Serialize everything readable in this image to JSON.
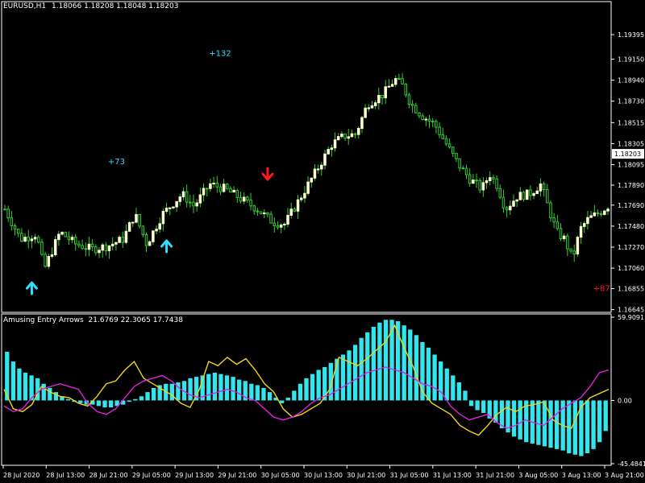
{
  "header": {
    "symbol": "EURUSD,H1",
    "ohlc": "1.18066 1.18208 1.18048 1.18203"
  },
  "indicator": {
    "name": "Amusing Entry Arrows",
    "values": "21.6769 22.3065 17.7438"
  },
  "colors": {
    "background": "#000000",
    "frame": "#ffffff",
    "bull_candle": "#ffffd0",
    "bear_candle": "#32cd32",
    "wick": "#32cd32",
    "up_arrow": "#33ddff",
    "down_arrow": "#ff1a1a",
    "histogram": "#33e6ee",
    "line_yellow": "#f2d21c",
    "line_magenta": "#dd22dd"
  },
  "chart_data": [
    {
      "type": "candlestick",
      "title": "EURUSD,H1",
      "price_ticks": [
        "1.19395",
        "1.19150",
        "1.18940",
        "1.18730",
        "1.18515",
        "1.18305",
        "1.18095",
        "1.17890",
        "1.17690",
        "1.17480",
        "1.17270",
        "1.17060",
        "1.16855",
        "1.16645"
      ],
      "ylim": [
        1.1665,
        1.195
      ],
      "current_price": "1.18203",
      "x_ticks": [
        "28 Jul 2020",
        "28 Jul 13:00",
        "28 Jul 21:00",
        "29 Jul 05:00",
        "29 Jul 13:00",
        "29 Jul 21:00",
        "30 Jul 05:00",
        "30 Jul 13:00",
        "30 Jul 21:00",
        "31 Jul 05:00",
        "31 Jul 13:00",
        "31 Jul 21:00",
        "3 Aug 05:00",
        "3 Aug 13:00",
        "3 Aug 21:00"
      ],
      "close_path": [
        [
          0,
          1.1765
        ],
        [
          4,
          1.1735
        ],
        [
          8,
          1.174
        ],
        [
          10,
          1.1705
        ],
        [
          14,
          1.1742
        ],
        [
          18,
          1.173
        ],
        [
          22,
          1.1725
        ],
        [
          26,
          1.1728
        ],
        [
          30,
          1.1735
        ],
        [
          33,
          1.176
        ],
        [
          36,
          1.173
        ],
        [
          40,
          1.176
        ],
        [
          45,
          1.178
        ],
        [
          48,
          1.1768
        ],
        [
          52,
          1.179
        ],
        [
          56,
          1.1785
        ],
        [
          60,
          1.1775
        ],
        [
          64,
          1.1765
        ],
        [
          68,
          1.1752
        ],
        [
          71,
          1.175
        ],
        [
          74,
          1.177
        ],
        [
          77,
          1.179
        ],
        [
          80,
          1.181
        ],
        [
          83,
          1.183
        ],
        [
          86,
          1.1838
        ],
        [
          89,
          1.184
        ],
        [
          92,
          1.187
        ],
        [
          96,
          1.188
        ],
        [
          99,
          1.1895
        ],
        [
          101,
          1.1888
        ],
        [
          103,
          1.187
        ],
        [
          106,
          1.1858
        ],
        [
          109,
          1.185
        ],
        [
          112,
          1.183
        ],
        [
          115,
          1.181
        ],
        [
          118,
          1.1795
        ],
        [
          121,
          1.1785
        ],
        [
          123,
          1.18
        ],
        [
          125,
          1.1788
        ],
        [
          127,
          1.1765
        ],
        [
          130,
          1.1778
        ],
        [
          133,
          1.178
        ],
        [
          136,
          1.179
        ],
        [
          138,
          1.1765
        ],
        [
          140,
          1.1742
        ],
        [
          142,
          1.1735
        ],
        [
          144,
          1.1715
        ],
        [
          146,
          1.1745
        ],
        [
          148,
          1.1755
        ],
        [
          151,
          1.1762
        ],
        [
          153,
          1.1768
        ]
      ],
      "annotations": [
        {
          "text": "+73",
          "index": 33,
          "price": 1.181,
          "color": "#33ddff"
        },
        {
          "text": "+132",
          "index": 63,
          "price": 1.1918,
          "color": "#33ddff"
        },
        {
          "text": "+87",
          "index": 177,
          "price": 1.1683,
          "color": "#ff1a1a"
        }
      ],
      "arrows": [
        {
          "dir": "up",
          "index": 8,
          "price": 1.1685
        },
        {
          "dir": "up",
          "index": 48,
          "price": 1.1727
        },
        {
          "dir": "down",
          "index": 78,
          "price": 1.1801
        }
      ]
    },
    {
      "type": "histogram_lines",
      "title": "Amusing Entry Arrows",
      "y_ticks": [
        "59.9091",
        "0.00",
        "-45.4841"
      ],
      "ylim": [
        -45.4841,
        59.9091
      ],
      "histogram": [
        35,
        28,
        23,
        20,
        18,
        16,
        12,
        9,
        6,
        3,
        1,
        -1,
        -2,
        -3,
        -3,
        -4,
        -5,
        -5,
        -4,
        -3,
        -1,
        1,
        3,
        6,
        9,
        11,
        12,
        12,
        13,
        14,
        16,
        17,
        18,
        19,
        20,
        19,
        18,
        17,
        15,
        14,
        12,
        11,
        9,
        6,
        2,
        -2,
        2,
        7,
        12,
        16,
        19,
        22,
        24,
        27,
        30,
        33,
        36,
        40,
        45,
        49,
        53,
        56,
        58,
        58,
        57,
        54,
        51,
        47,
        42,
        38,
        33,
        28,
        23,
        18,
        13,
        7,
        -4,
        -7,
        -9,
        -13,
        -16,
        -20,
        -23,
        -26,
        -28,
        -30,
        -31,
        -32,
        -33,
        -34,
        -35,
        -36,
        -38,
        -39,
        -40,
        -38,
        -35,
        -30,
        -22
      ],
      "series": [
        {
          "color": "#f2d21c",
          "values": [
            8,
            -6,
            -8,
            -3,
            10,
            6,
            3,
            2,
            -2,
            -4,
            3,
            12,
            14,
            22,
            28,
            16,
            12,
            8,
            4,
            -2,
            -5,
            8,
            28,
            25,
            31,
            26,
            30,
            22,
            12,
            6,
            -6,
            -12,
            -10,
            -6,
            -2,
            8,
            31,
            28,
            25,
            30,
            36,
            42,
            54,
            38,
            24,
            6,
            -2,
            -6,
            -10,
            -18,
            -22,
            -25,
            -18,
            -10,
            -5,
            -8,
            -4,
            -3,
            -1,
            -14,
            -18,
            -20,
            -5,
            2,
            5,
            8
          ]
        },
        {
          "color": "#dd22dd",
          "values": [
            -4,
            -8,
            -6,
            2,
            8,
            10,
            12,
            10,
            8,
            -2,
            -8,
            -10,
            -6,
            2,
            10,
            14,
            16,
            18,
            14,
            8,
            4,
            2,
            4,
            6,
            8,
            6,
            2,
            0,
            -6,
            -12,
            -14,
            -12,
            -8,
            -2,
            2,
            4,
            8,
            12,
            16,
            20,
            22,
            24,
            22,
            20,
            16,
            12,
            10,
            6,
            -4,
            -10,
            -14,
            -12,
            -10,
            -16,
            -20,
            -18,
            -14,
            -16,
            -18,
            -12,
            -6,
            -2,
            2,
            10,
            20,
            22
          ]
        }
      ]
    }
  ]
}
